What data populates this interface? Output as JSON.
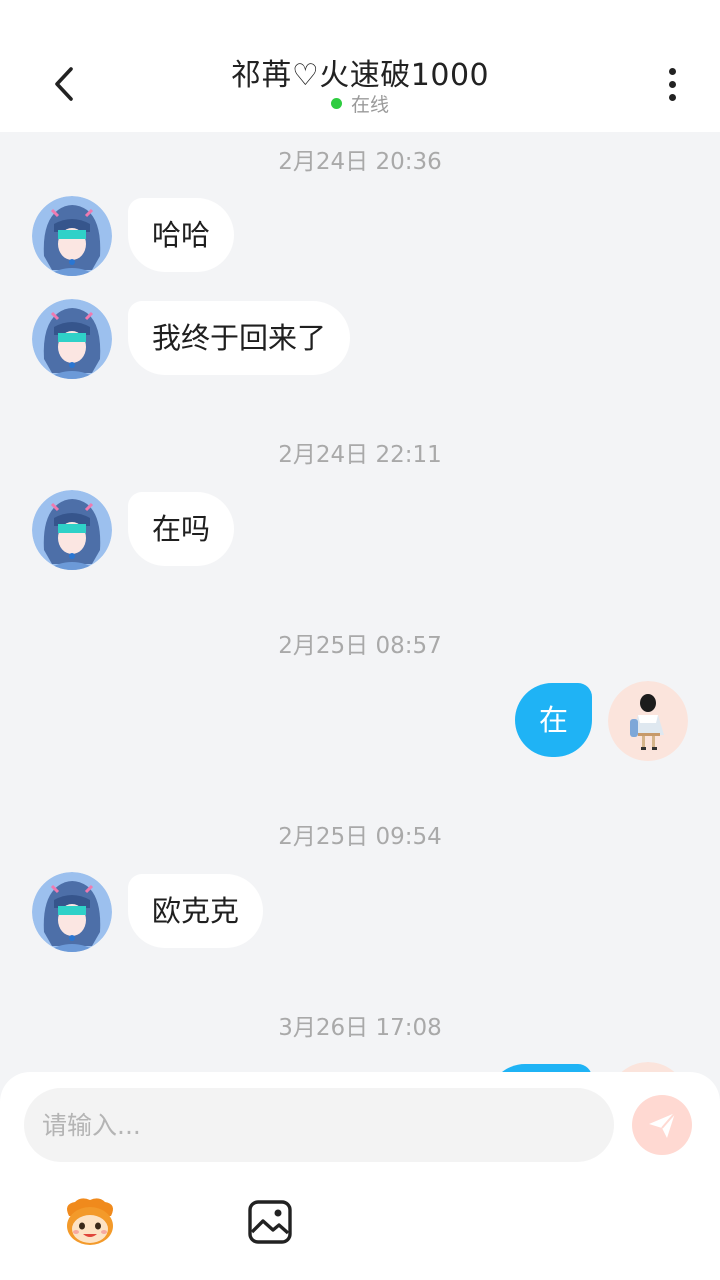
{
  "header": {
    "title": "祁苒♡火速破1000",
    "status": "在线",
    "back_icon": "chevron-left-icon",
    "more_icon": "more-vertical-icon"
  },
  "messages": [
    {
      "timestamp": "2月24日 20:36"
    },
    {
      "from": "other",
      "text": "哈哈"
    },
    {
      "from": "other",
      "text": "我终于回来了"
    },
    {
      "timestamp": "2月24日 22:11"
    },
    {
      "from": "other",
      "text": "在吗"
    },
    {
      "timestamp": "2月25日 08:57"
    },
    {
      "from": "me",
      "text": "在"
    },
    {
      "timestamp": "2月25日 09:54"
    },
    {
      "from": "other",
      "text": "欧克克"
    },
    {
      "timestamp": "3月26日 17:08"
    },
    {
      "from": "me",
      "text": ""
    }
  ],
  "composer": {
    "placeholder": "请输入...",
    "send_icon": "send-paper-plane-icon",
    "tools": [
      "emoji-icon",
      "image-icon"
    ]
  },
  "colors": {
    "accent": "#1fb3f5",
    "online": "#2ecc40",
    "send_button": "#ffd9d2",
    "background": "#f3f4f6"
  }
}
